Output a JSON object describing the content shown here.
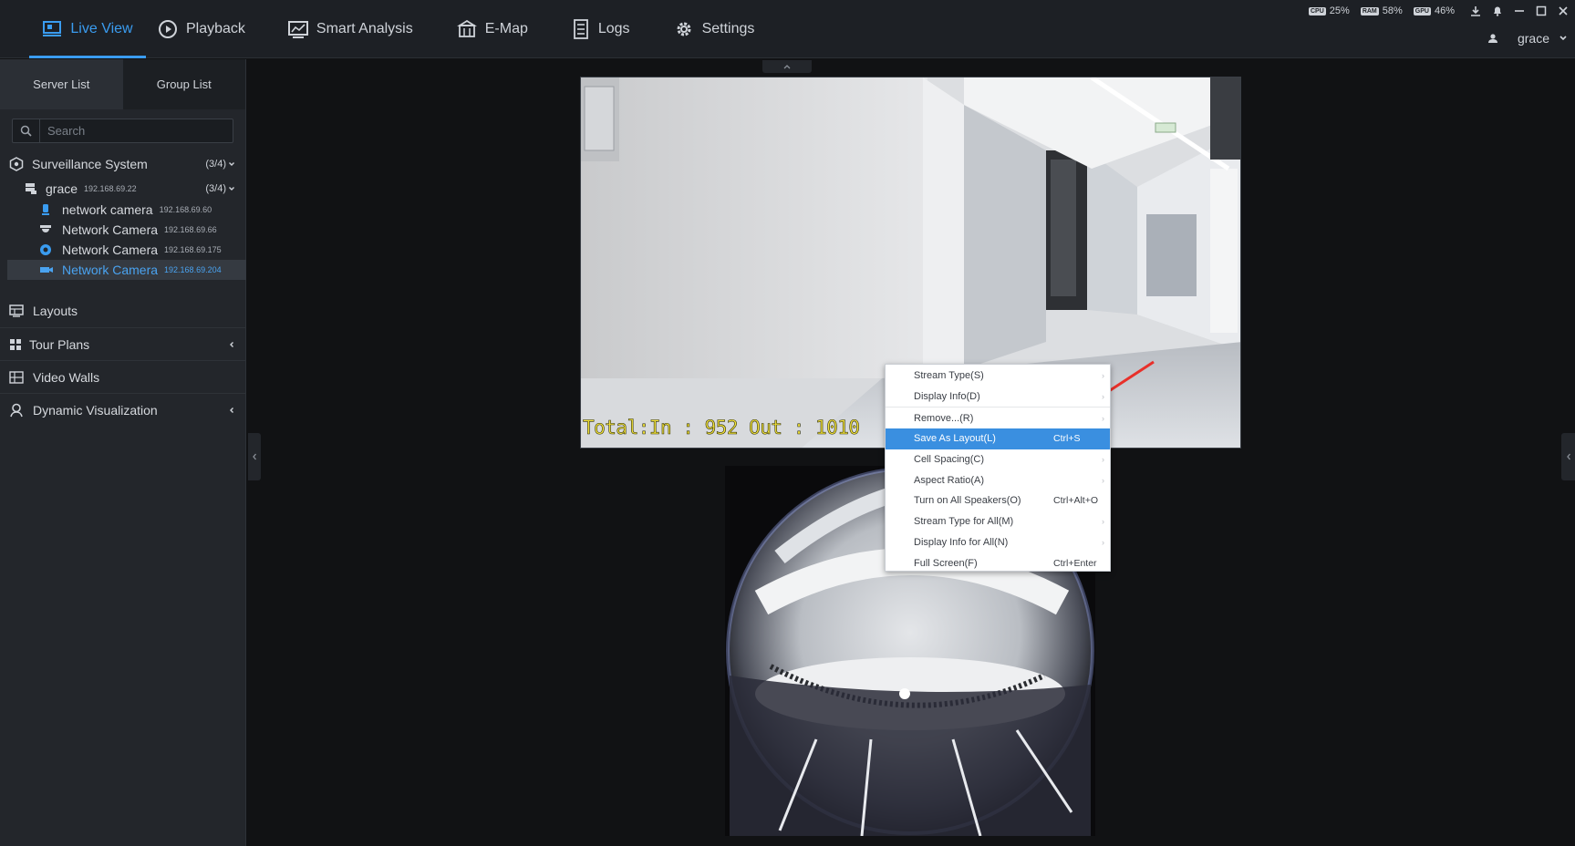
{
  "nav": {
    "items": [
      {
        "label": "Live View",
        "icon": "monitor-icon",
        "active": true
      },
      {
        "label": "Playback",
        "icon": "playback-icon"
      },
      {
        "label": "Smart Analysis",
        "icon": "analysis-icon"
      },
      {
        "label": "E-Map",
        "icon": "map-icon"
      },
      {
        "label": "Logs",
        "icon": "logs-icon"
      },
      {
        "label": "Settings",
        "icon": "gear-icon"
      }
    ]
  },
  "system": {
    "cpu_label": "CPU",
    "cpu": "25%",
    "ram_label": "RAM",
    "ram": "58%",
    "gpu_label": "GPU",
    "gpu": "46%"
  },
  "user": {
    "name": "grace"
  },
  "sidebar": {
    "tabs": [
      "Server List",
      "Group List"
    ],
    "search_placeholder": "Search",
    "root": {
      "label": "Surveillance System",
      "count": "(3/4)"
    },
    "server": {
      "label": "grace",
      "ip": "192.168.69.22",
      "count": "(3/4)"
    },
    "cameras": [
      {
        "label": "network camera",
        "ip": "192.168.69.60",
        "icon": "bullet-camera-icon"
      },
      {
        "label": "Network Camera",
        "ip": "192.168.69.66",
        "icon": "dome-camera-icon"
      },
      {
        "label": "Network Camera",
        "ip": "192.168.69.175",
        "icon": "fisheye-camera-icon"
      },
      {
        "label": "Network Camera",
        "ip": "192.168.69.204",
        "icon": "box-camera-icon",
        "selected": true
      }
    ],
    "sections": [
      {
        "label": "Layouts",
        "icon": "layout-icon"
      },
      {
        "label": "Tour Plans",
        "icon": "tour-icon",
        "expandable": true
      },
      {
        "label": "Video Walls",
        "icon": "videowall-icon"
      },
      {
        "label": "Dynamic Visualization",
        "icon": "visualization-icon",
        "expandable": true
      }
    ]
  },
  "video": {
    "overlay_text": "Total:In : 952  Out : 1010"
  },
  "context_menu": {
    "items": [
      {
        "label": "Stream Type(S)",
        "shortcut": "",
        "submenu": true
      },
      {
        "label": "Display Info(D)",
        "shortcut": "",
        "submenu": true
      },
      {
        "label": "Remove...(R)",
        "shortcut": "",
        "submenu": true
      },
      {
        "label": "Save As Layout(L)",
        "shortcut": "Ctrl+S",
        "highlighted": true
      },
      {
        "label": "Cell Spacing(C)",
        "shortcut": "",
        "submenu": true
      },
      {
        "label": "Aspect Ratio(A)",
        "shortcut": "",
        "submenu": true
      },
      {
        "label": "Turn on All Speakers(O)",
        "shortcut": "Ctrl+Alt+O"
      },
      {
        "label": "Stream Type for All(M)",
        "shortcut": "",
        "submenu": true
      },
      {
        "label": "Display Info for All(N)",
        "shortcut": "",
        "submenu": true
      },
      {
        "label": "Full Screen(F)",
        "shortcut": "Ctrl+Enter"
      }
    ]
  },
  "colors": {
    "accent": "#3a9cf0",
    "highlight": "#3a8fe0",
    "annotation_arrow": "#e8302a"
  }
}
